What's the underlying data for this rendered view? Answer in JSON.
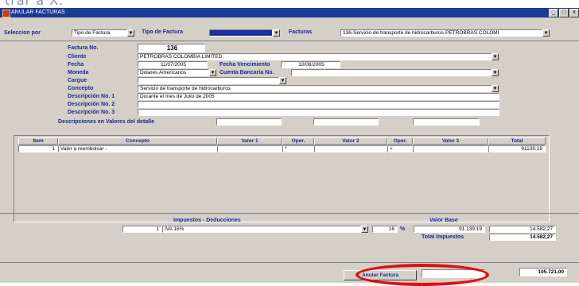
{
  "top_strip_text": "trar a X.",
  "window": {
    "title": "ANULAR FACTURAS",
    "controls": [
      "_",
      "□",
      "x"
    ]
  },
  "toolbar": {
    "seleccion_label": "Seleccion por",
    "seleccion_value": "Tipo de Factura",
    "tipo_label": "Tipo de Factura",
    "tipo_value": "",
    "facturas_label": "Facturas",
    "facturas_value": "136-Servicio de transporte de hidrocarburos-PETROBRAS COLOMI"
  },
  "factura": {
    "numero_label": "Factura No.",
    "numero": "136",
    "cliente_label": "Cliente",
    "cliente": "PETROBRAS COLOMBIA LIMITED.",
    "fecha_label": "Fecha",
    "fecha": "11/07/2005",
    "venc_label": "Fecha Vencimiento",
    "venc": "10/08/2005",
    "moneda_label": "Moneda",
    "moneda": "Dolares Americanos",
    "cuenta_label": "Cuenta Bancaria No.",
    "cuenta": "",
    "cargue_label": "Cargue",
    "cargue": "",
    "concepto_label": "Concepto",
    "concepto": "Servicio de transporte de hidrocarburos",
    "desc1_label": "Descripción No. 1",
    "desc1": "Durante el mes de Julio de 2005",
    "desc2_label": "Descripción No. 2",
    "desc2": "",
    "desc3_label": "Descripción No. 3",
    "desc3": "",
    "desc_valores_label": "Descripciones en Valores del detalle"
  },
  "detail_table": {
    "headers": [
      "Item",
      "Concepto",
      "Valor 1",
      "Oper.",
      "Valor 2",
      "Oper.",
      "Valor 3",
      "Total"
    ],
    "rows": [
      {
        "item": "1",
        "concepto": "Valor a reembolsar -",
        "valor1": "",
        "oper1": "*",
        "valor2": "",
        "oper2": "+",
        "valor3": "",
        "total": "91139,19"
      }
    ]
  },
  "impuestos": {
    "header": "Impuestos - Deducciones",
    "valor_base_header": "Valor Base",
    "row": {
      "num": "1",
      "name": "IVA 16%",
      "pct": "16",
      "pct_sign": "%",
      "base": "91.139,19",
      "amount": "14.582,27"
    },
    "total_label": "Total Impuestos",
    "total": "14.582,27"
  },
  "footer": {
    "anular_button": "Anular Factura",
    "grand_total": "105.721,00"
  },
  "colors": {
    "label_blue": "#1a2a8c",
    "form_bg": "#d4d0c8",
    "titlebar": "#1b3a94",
    "highlight_ring": "#e01010"
  }
}
